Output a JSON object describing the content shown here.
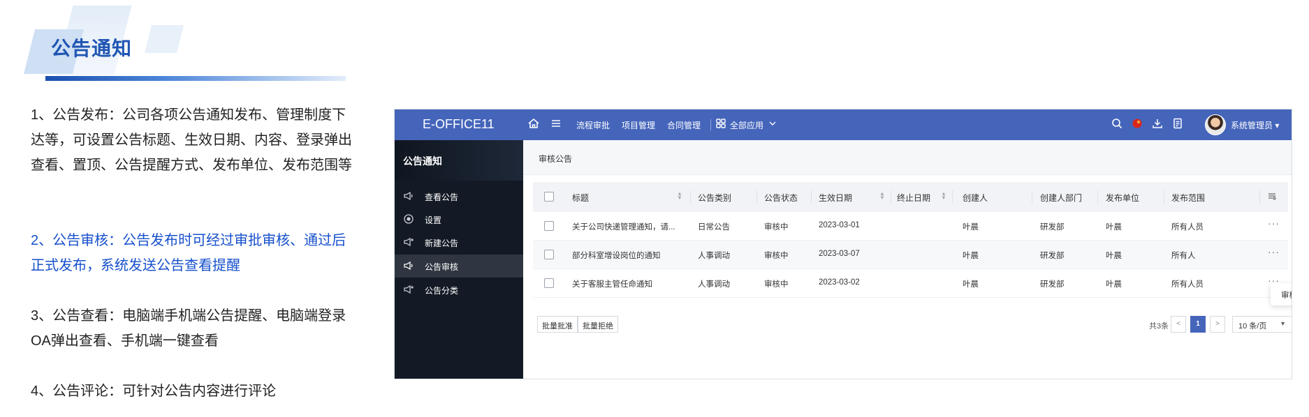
{
  "slide": {
    "title": "公告通知",
    "paragraphs": [
      "1、公告发布：公司各项公告通知发布、管理制度下达等，可设置公告标题、生效日期、内容、登录弹出查看、置顶、公告提醒方式、发布单位、发布范围等",
      "2、公告审核：公告发布时可经过审批审核、通过后正式发布，系统发送公告查看提醒",
      "3、公告查看：电脑端手机端公告提醒、电脑端登录OA弹出查看、手机端一键查看",
      "4、公告评论：可针对公告内容进行评论"
    ],
    "highlight_color": "#1650cc",
    "title_color": "#1f55b3"
  },
  "app": {
    "brand": "E-OFFICE11",
    "topbar_color": "#4565bb",
    "nav": {
      "approval": "流程审批",
      "project": "项目管理",
      "contract": "合同管理",
      "all_apps": "全部应用"
    },
    "user": "系统管理员",
    "sidebar": {
      "title": "公告通知",
      "items": [
        {
          "label": "查看公告",
          "icon": "megaphone-icon"
        },
        {
          "label": "设置",
          "icon": "settings-icon"
        },
        {
          "label": "新建公告",
          "icon": "megaphone-add-icon"
        },
        {
          "label": "公告审核",
          "icon": "megaphone-icon",
          "active": true
        },
        {
          "label": "公告分类",
          "icon": "megaphone-add-icon"
        }
      ]
    },
    "breadcrumb": "审核公告",
    "table": {
      "headers": {
        "title": "标题",
        "category": "公告类别",
        "status": "公告状态",
        "effective": "生效日期",
        "end": "终止日期",
        "creator": "创建人",
        "dept": "创建人部门",
        "unit": "发布单位",
        "scope": "发布范围"
      },
      "rows": [
        {
          "title": "关于公司快递管理通知，请...",
          "category": "日常公告",
          "status": "审核中",
          "effective": "2023-03-01",
          "end": "",
          "creator": "叶晨",
          "dept": "研发部",
          "unit": "叶晨",
          "scope": "所有人员"
        },
        {
          "title": "部分科室增设岗位的通知",
          "category": "人事调动",
          "status": "审核中",
          "effective": "2023-03-07",
          "end": "",
          "creator": "叶晨",
          "dept": "研发部",
          "unit": "叶晨",
          "scope": "所有人"
        },
        {
          "title": "关于客服主管任命通知",
          "category": "人事调动",
          "status": "审核中",
          "effective": "2023-03-02",
          "end": "",
          "creator": "叶晨",
          "dept": "研发部",
          "unit": "叶晨",
          "scope": "所有人员"
        }
      ],
      "popup_action": "审核"
    },
    "actions": {
      "batch_approve": "批量批准",
      "batch_reject": "批量拒绝"
    },
    "pagination": {
      "total": "共3条",
      "prev": "<",
      "current": "1",
      "next": ">",
      "page_size": "10 条/页"
    }
  }
}
